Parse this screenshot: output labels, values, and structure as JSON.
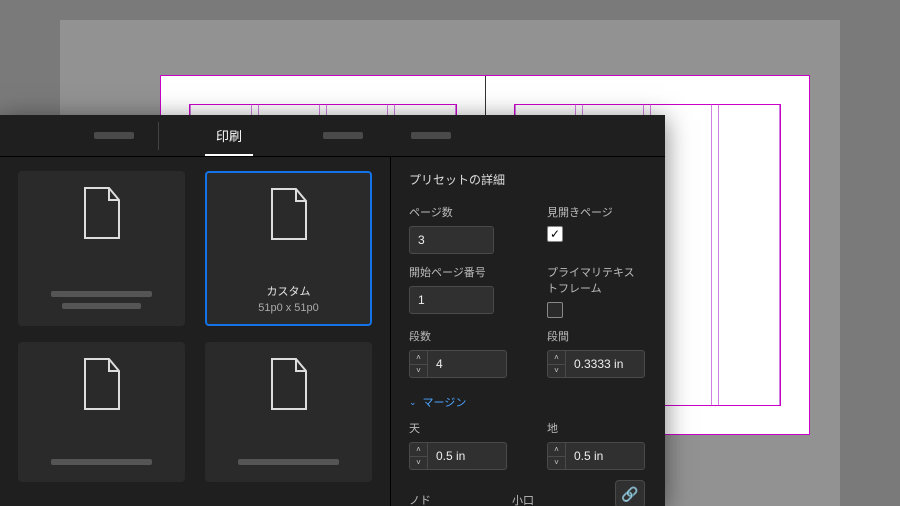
{
  "tabs": {
    "active": "印刷"
  },
  "presets": {
    "selected_index": 1,
    "items": [
      {
        "title": "",
        "sub": ""
      },
      {
        "title": "カスタム",
        "sub": "51p0 x 51p0"
      },
      {
        "title": "",
        "sub": ""
      },
      {
        "title": "",
        "sub": ""
      }
    ]
  },
  "details": {
    "header": "プリセットの詳細",
    "page_count": {
      "label": "ページ数",
      "value": "3"
    },
    "facing": {
      "label": "見開きページ",
      "checked": true
    },
    "start_page": {
      "label": "開始ページ番号",
      "value": "1"
    },
    "primary_text_frame": {
      "label": "プライマリテキストフレーム",
      "checked": false
    },
    "columns": {
      "label": "段数",
      "value": "4"
    },
    "gutter": {
      "label": "段間",
      "value": "0.3333 in"
    },
    "margin_section": "マージン",
    "margin_top": {
      "label": "天",
      "value": "0.5 in"
    },
    "margin_bottom": {
      "label": "地",
      "value": "0.5 in"
    },
    "margin_inside": {
      "label": "ノド"
    },
    "margin_outside": {
      "label": "小口"
    }
  },
  "icons": {
    "link": "🔗"
  }
}
